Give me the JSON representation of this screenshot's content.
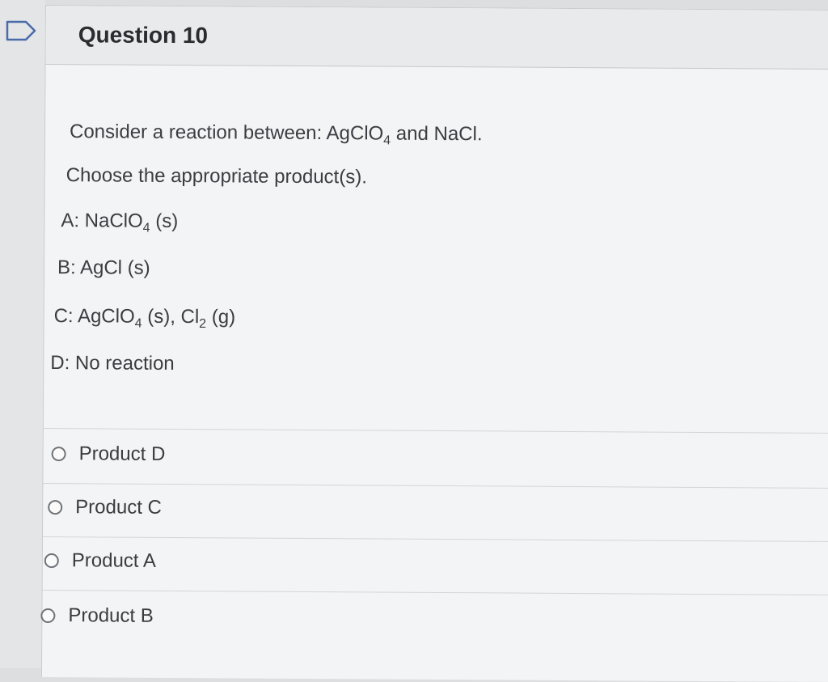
{
  "question": {
    "title": "Question 10",
    "stem": "Consider a reaction between: AgClO",
    "stem_sub": "4",
    "stem_end": " and NaCl.",
    "instruction": "Choose the appropriate product(s).",
    "options": [
      {
        "pre": "A: NaClO",
        "sub": "4",
        "post": " (s)"
      },
      {
        "pre": "B: AgCl (s)"
      },
      {
        "pre": "C: AgClO",
        "sub": "4",
        "mid": " (s), Cl",
        "sub2": "2",
        "post": " (g)"
      },
      {
        "pre": "D: No reaction"
      }
    ]
  },
  "answers": [
    {
      "label": "Product D"
    },
    {
      "label": "Product C"
    },
    {
      "label": "Product A"
    },
    {
      "label": "Product B"
    }
  ]
}
